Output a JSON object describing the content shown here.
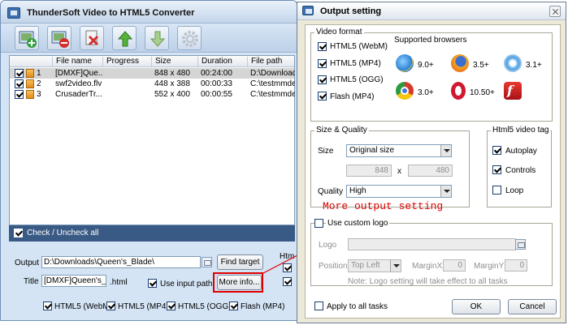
{
  "main_window": {
    "title": "ThunderSoft Video to HTML5 Converter",
    "toolbar": {
      "icons": [
        "add-video-icon",
        "remove-video-icon",
        "clear-list-icon",
        "move-up-icon",
        "move-down-icon",
        "settings-gear-icon"
      ]
    },
    "file_list": {
      "columns": [
        "File name",
        "Progress",
        "Size",
        "Duration",
        "File path"
      ],
      "rows": [
        {
          "index": "1",
          "name": "[DMXF]Que...",
          "progress": "",
          "size": "848 x 480",
          "duration": "00:24:00",
          "path": "D:\\Downloads",
          "checked": true,
          "selected": true
        },
        {
          "index": "2",
          "name": "swf2video.flv",
          "progress": "",
          "size": "448 x 388",
          "duration": "00:00:33",
          "path": "C:\\testmmdev",
          "checked": true,
          "selected": false
        },
        {
          "index": "3",
          "name": "CrusaderTr...",
          "progress": "",
          "size": "552 x 400",
          "duration": "00:00:55",
          "path": "C:\\testmmdev",
          "checked": true,
          "selected": false
        }
      ]
    },
    "check_all_label": "Check / Uncheck all",
    "output_label": "Output",
    "output_value": "D:\\Downloads\\Queen's_Blade\\",
    "find_target_label": "Find target",
    "title_label": "Title",
    "title_value": "[DMXF]Queen's_Bla",
    "title_ext": ".html",
    "use_input_path_label": "Use input path",
    "more_info_label": "More info...",
    "html_partial": "Htm",
    "formats": [
      {
        "label": "HTML5 (WebM)",
        "checked": true
      },
      {
        "label": "HTML5 (MP4)",
        "checked": true
      },
      {
        "label": "HTML5 (OGG)",
        "checked": true
      },
      {
        "label": "Flash (MP4)",
        "checked": true
      }
    ]
  },
  "dialog": {
    "title": "Output setting",
    "video_format": {
      "legend": "Video format",
      "options": [
        {
          "label": "HTML5 (WebM)",
          "checked": true
        },
        {
          "label": "HTML5 (MP4)",
          "checked": true
        },
        {
          "label": "HTML5 (OGG)",
          "checked": true
        },
        {
          "label": "Flash (MP4)",
          "checked": true
        }
      ],
      "browsers_heading": "Supported browsers",
      "browsers": [
        {
          "icon": "ie-browser-icon",
          "version": "9.0+",
          "color": "#2a7fd4"
        },
        {
          "icon": "firefox-browser-icon",
          "version": "3.5+",
          "color": "#e8691c"
        },
        {
          "icon": "safari-browser-icon",
          "version": "3.1+",
          "color": "#4aa0e6"
        },
        {
          "icon": "chrome-browser-icon",
          "version": "3.0+",
          "color": "#2e9b43"
        },
        {
          "icon": "opera-browser-icon",
          "version": "10.50+",
          "color": "#d01830"
        },
        {
          "icon": "flash-player-icon",
          "version": "",
          "color": "#c8151c"
        }
      ]
    },
    "size_quality": {
      "legend": "Size & Quality",
      "size_label": "Size",
      "size_value": "Original size",
      "width": "848",
      "x_sep": "x",
      "height": "480",
      "quality_label": "Quality",
      "quality_value": "High"
    },
    "html5_tag": {
      "legend": "Html5 video tag",
      "options": [
        {
          "label": "Autoplay",
          "checked": true
        },
        {
          "label": "Controls",
          "checked": true
        },
        {
          "label": "Loop",
          "checked": false
        }
      ]
    },
    "logo": {
      "use_custom_logo_label": "Use custom logo",
      "logo_label": "Logo",
      "position_label": "Position",
      "position_value": "Top Left",
      "margin_x_label": "MarginX",
      "margin_x_value": "0",
      "margin_y_label": "MarginY",
      "margin_y_value": "0",
      "note": "Note: Logo setting will take effect to all tasks"
    },
    "apply_all_label": "Apply to all tasks",
    "ok_label": "OK",
    "cancel_label": "Cancel"
  },
  "annotation": {
    "callout_text": "More output setting",
    "color": "#e00000"
  }
}
